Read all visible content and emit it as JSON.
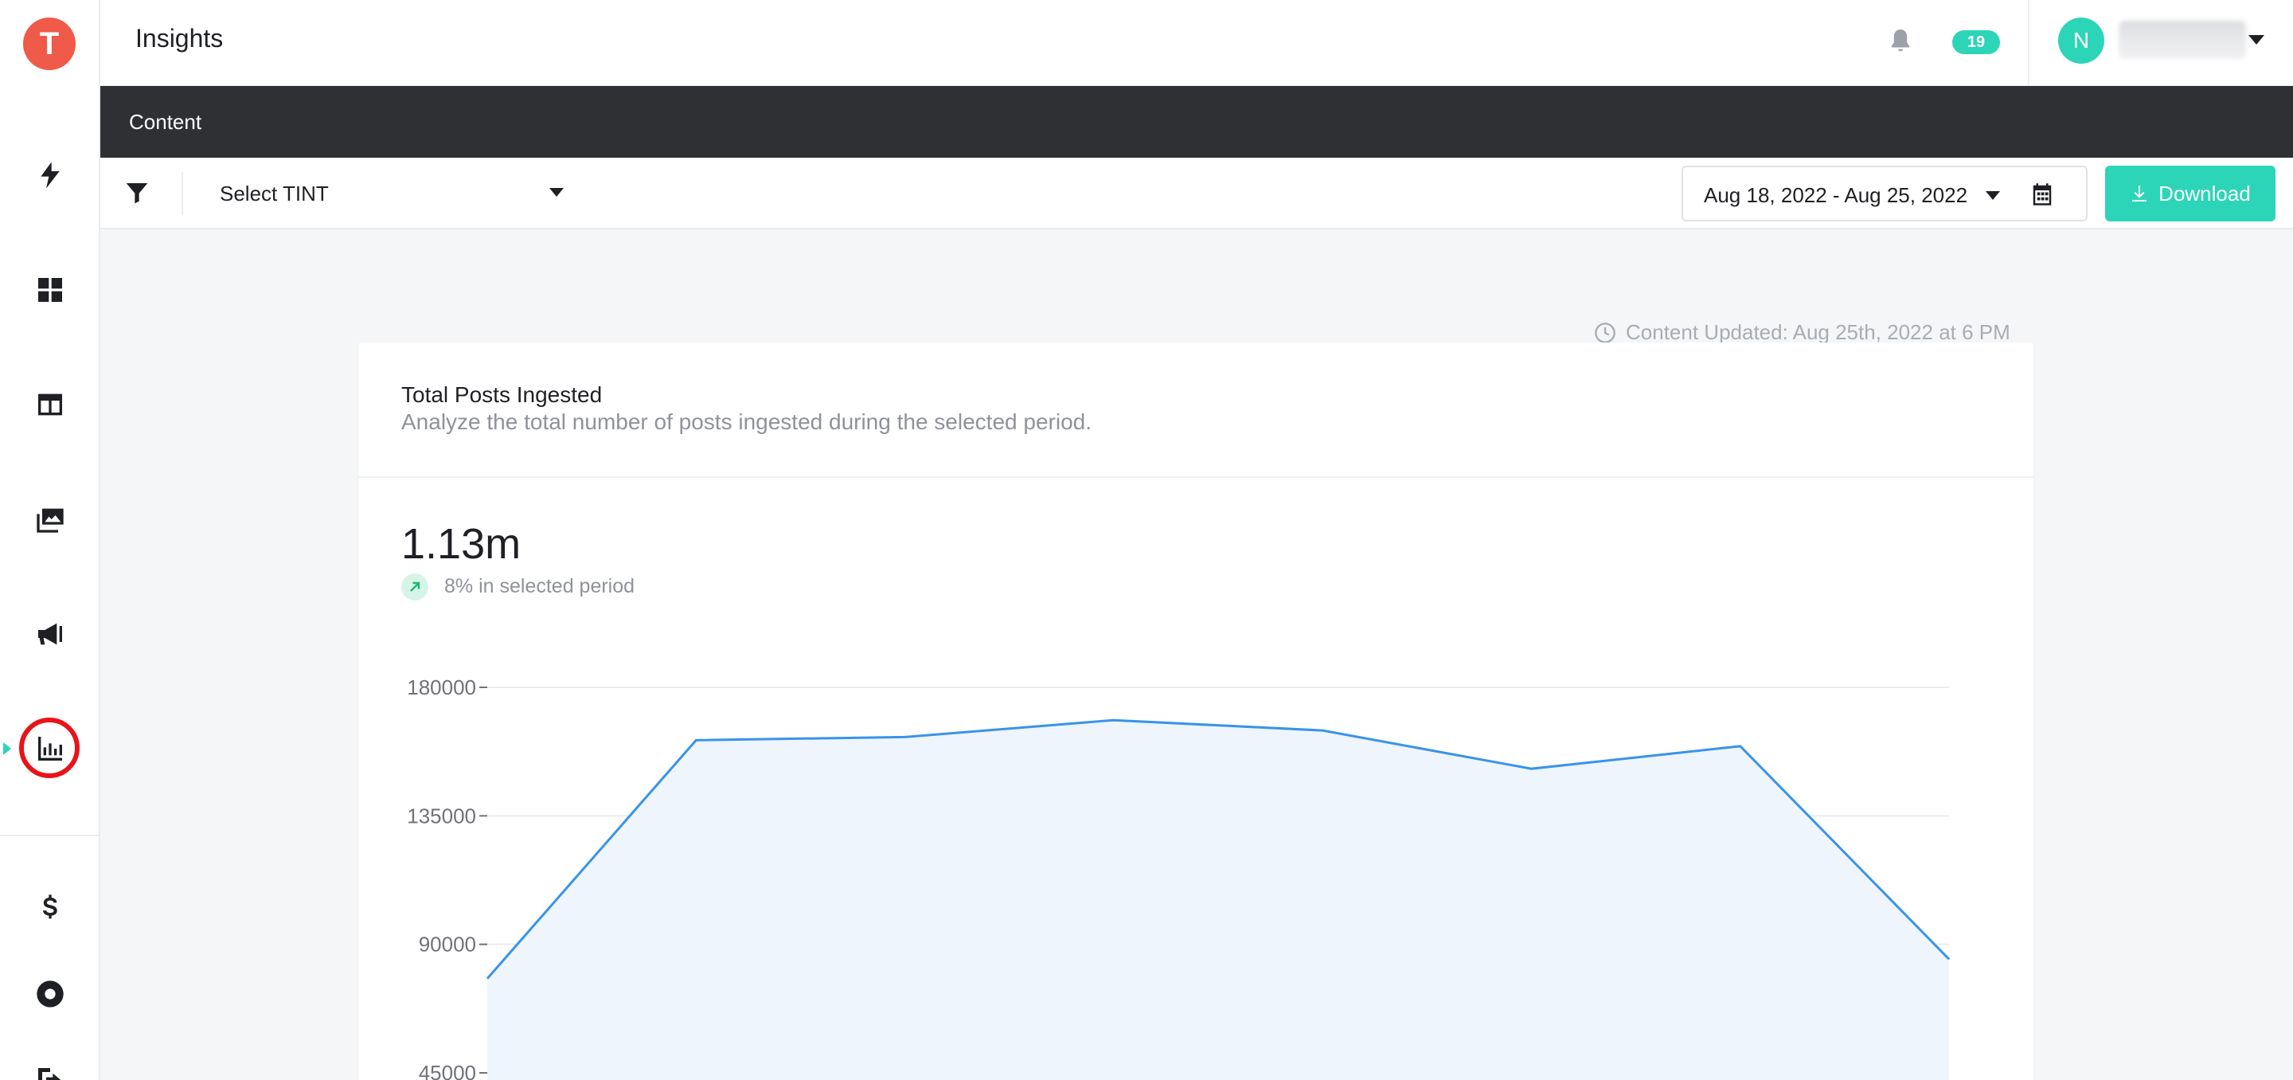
{
  "app": {
    "page_title": "Insights",
    "section_title": "Content"
  },
  "sidebar": {
    "logo_letter": "T",
    "items": [
      {
        "name": "lightning-icon"
      },
      {
        "name": "dashboard-grid-icon"
      },
      {
        "name": "layout-icon"
      },
      {
        "name": "media-gallery-icon"
      },
      {
        "name": "megaphone-icon"
      },
      {
        "name": "bar-chart-icon",
        "active": true
      },
      {
        "name": "dollar-icon"
      },
      {
        "name": "lifebuoy-icon"
      },
      {
        "name": "logout-icon"
      }
    ]
  },
  "header": {
    "notification_count": "19",
    "avatar_initial": "N"
  },
  "filters": {
    "tint_select_label": "Select TINT",
    "date_range_label": "Aug 18, 2022 - Aug 25, 2022",
    "download_label": "Download"
  },
  "content_updated": "Content Updated: Aug 25th, 2022 at 6 PM",
  "card": {
    "title": "Total Posts Ingested",
    "subtitle": "Analyze the total number of posts ingested during the selected period.",
    "metric": "1.13m",
    "trend_text": "8% in selected period"
  },
  "colors": {
    "accent": "#2cd5b7",
    "logo": "#f05a48",
    "line": "#3a93e8",
    "area": "#eef5fd",
    "active_marker": "#e8141a"
  },
  "chart_data": {
    "type": "area",
    "title": "",
    "xlabel": "",
    "ylabel": "",
    "y_ticks": [
      "180000",
      "135000",
      "90000",
      "45000"
    ],
    "ylim": [
      0,
      180000
    ],
    "series": [
      {
        "values": [
          78000,
          161500,
          162600,
          168500,
          164900,
          151500,
          159400,
          84800
        ]
      }
    ],
    "grid": true
  }
}
